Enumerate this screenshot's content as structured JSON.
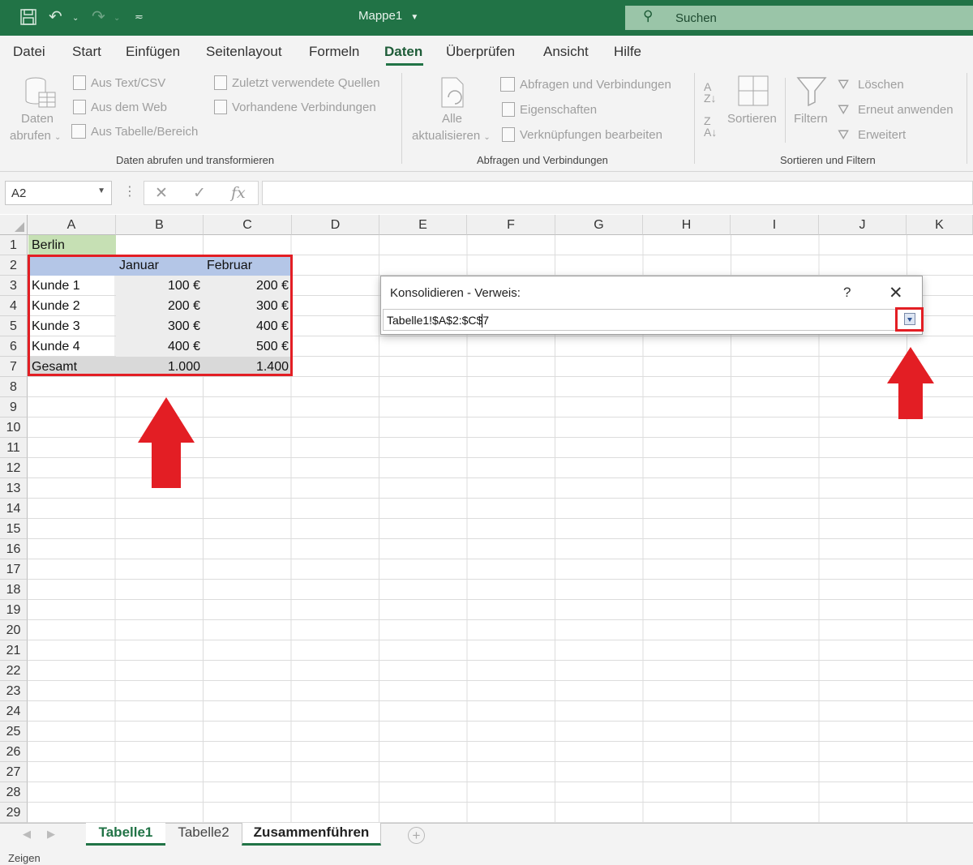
{
  "window": {
    "title": "Mappe1",
    "title_dropdown_icon": "chevron-down-icon",
    "search_placeholder": "Suchen"
  },
  "menu": [
    "Datei",
    "Start",
    "Einfügen",
    "Seitenlayout",
    "Formeln",
    "Daten",
    "Überprüfen",
    "Ansicht",
    "Hilfe"
  ],
  "menu_active": "Daten",
  "ribbon": {
    "get_data": {
      "line1": "Daten",
      "line2": "abrufen"
    },
    "from_text": "Aus Text/CSV",
    "from_web": "Aus dem Web",
    "from_table": "Aus Tabelle/Bereich",
    "recent_sources": "Zuletzt verwendete Quellen",
    "existing_connections": "Vorhandene Verbindungen",
    "group1": "Daten abrufen und transformieren",
    "refresh_all": {
      "line1": "Alle",
      "line2": "aktualisieren"
    },
    "queries_connections": "Abfragen und Verbindungen",
    "properties": "Eigenschaften",
    "edit_links": "Verknüpfungen bearbeiten",
    "group2": "Abfragen und Verbindungen",
    "sort": "Sortieren",
    "filter": "Filtern",
    "clear": "Löschen",
    "reapply": "Erneut anwenden",
    "advanced": "Erweitert",
    "group3": "Sortieren und Filtern"
  },
  "formula_bar": {
    "name_box": "A2",
    "formula": ""
  },
  "columns": [
    "A",
    "B",
    "C",
    "D",
    "E",
    "F",
    "G",
    "H",
    "I",
    "J",
    "K"
  ],
  "rows": [
    "1",
    "2",
    "3",
    "4",
    "5",
    "6",
    "7",
    "8",
    "9",
    "10",
    "11",
    "12",
    "13",
    "14",
    "15",
    "16",
    "17",
    "18",
    "19",
    "20",
    "21",
    "22",
    "23",
    "24",
    "25",
    "26",
    "27",
    "28",
    "29"
  ],
  "cells": {
    "a1": "Berlin",
    "b2": "Januar",
    "c2": "Februar",
    "a3": "Kunde 1",
    "b3": "100 €",
    "c3": "200 €",
    "a4": "Kunde 2",
    "b4": "200 €",
    "c4": "300 €",
    "a5": "Kunde 3",
    "b5": "300 €",
    "c5": "400 €",
    "a6": "Kunde 4",
    "b6": "400 €",
    "c6": "500 €",
    "a7": "Gesamt",
    "b7": "1.000",
    "c7": "1.400"
  },
  "dialog": {
    "title": "Konsolidieren - Verweis:",
    "help": "?",
    "close": "✕",
    "reference": "Tabelle1!$A$2:$C$7",
    "collapse_icon": "expand-dialog-icon"
  },
  "sheets": [
    "Tabelle1",
    "Tabelle2",
    "Zusammenführen"
  ],
  "status": "Zeigen",
  "colors": {
    "excel_green": "#217346",
    "highlight_red": "#e31e24"
  }
}
